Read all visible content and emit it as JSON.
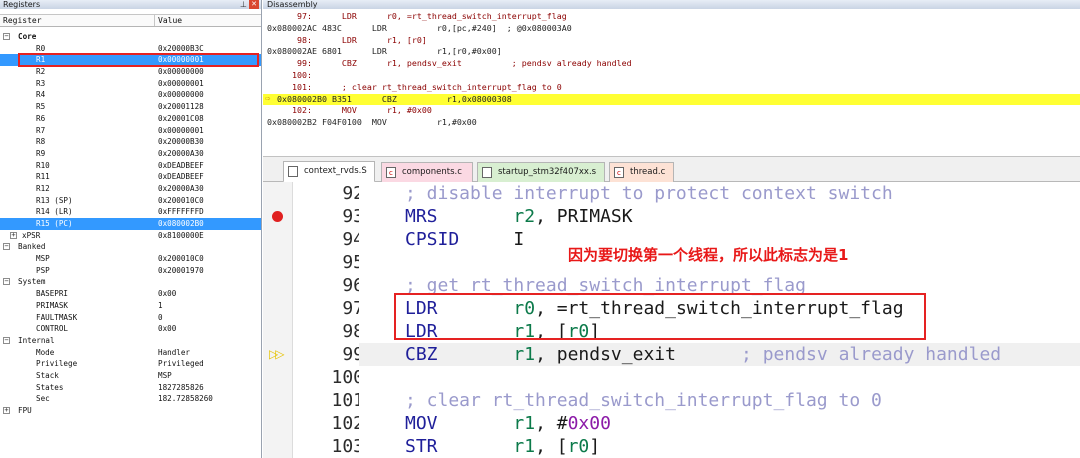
{
  "registers_panel": {
    "title": "Registers",
    "close_label": "✕",
    "pin_label": "⊥",
    "col_register": "Register",
    "col_value": "Value",
    "rows": [
      {
        "name": "Core",
        "value": "",
        "level": 0,
        "expander": "−",
        "group": true
      },
      {
        "name": "R0",
        "value": "0x20000B3C",
        "level": 2
      },
      {
        "name": "R1",
        "value": "0x00000001",
        "level": 2,
        "selected": true
      },
      {
        "name": "R2",
        "value": "0x00000000",
        "level": 2
      },
      {
        "name": "R3",
        "value": "0x00000001",
        "level": 2
      },
      {
        "name": "R4",
        "value": "0x00000000",
        "level": 2
      },
      {
        "name": "R5",
        "value": "0x20001128",
        "level": 2
      },
      {
        "name": "R6",
        "value": "0x20001C08",
        "level": 2
      },
      {
        "name": "R7",
        "value": "0x00000001",
        "level": 2
      },
      {
        "name": "R8",
        "value": "0x20000B30",
        "level": 2
      },
      {
        "name": "R9",
        "value": "0x20000A30",
        "level": 2
      },
      {
        "name": "R10",
        "value": "0xDEADBEEF",
        "level": 2
      },
      {
        "name": "R11",
        "value": "0xDEADBEEF",
        "level": 2
      },
      {
        "name": "R12",
        "value": "0x20000A30",
        "level": 2
      },
      {
        "name": "R13 (SP)",
        "value": "0x200010C0",
        "level": 2
      },
      {
        "name": "R14 (LR)",
        "value": "0xFFFFFFFD",
        "level": 2
      },
      {
        "name": "R15 (PC)",
        "value": "0x080002B0",
        "level": 2,
        "selected": true
      },
      {
        "name": "xPSR",
        "value": "0x8100000E",
        "level": 1,
        "expander": "+"
      },
      {
        "name": "Banked",
        "value": "",
        "level": 0,
        "expander": "−"
      },
      {
        "name": "MSP",
        "value": "0x200010C0",
        "level": 2
      },
      {
        "name": "PSP",
        "value": "0x20001970",
        "level": 2
      },
      {
        "name": "System",
        "value": "",
        "level": 0,
        "expander": "−"
      },
      {
        "name": "BASEPRI",
        "value": "0x00",
        "level": 2
      },
      {
        "name": "PRIMASK",
        "value": "1",
        "level": 2
      },
      {
        "name": "FAULTMASK",
        "value": "0",
        "level": 2
      },
      {
        "name": "CONTROL",
        "value": "0x00",
        "level": 2
      },
      {
        "name": "Internal",
        "value": "",
        "level": 0,
        "expander": "−"
      },
      {
        "name": "Mode",
        "value": "Handler",
        "level": 2
      },
      {
        "name": "Privilege",
        "value": "Privileged",
        "level": 2
      },
      {
        "name": "Stack",
        "value": "MSP",
        "level": 2
      },
      {
        "name": "States",
        "value": "1827285826",
        "level": 2
      },
      {
        "name": "Sec",
        "value": "182.72858260",
        "level": 2
      },
      {
        "name": "FPU",
        "value": "",
        "level": 0,
        "expander": "+"
      }
    ]
  },
  "disassembly": {
    "title": "Disassembly",
    "lines": [
      {
        "text": "      97:      LDR      r0, =rt_thread_switch_interrupt_flag",
        "kind": "src"
      },
      {
        "text": "0x080002AC 483C      LDR          r0,[pc,#240]  ; @0x080003A0",
        "kind": "addr"
      },
      {
        "text": "      98:      LDR      r1, [r0]",
        "kind": "src"
      },
      {
        "text": "0x080002AE 6801      LDR          r1,[r0,#0x00]",
        "kind": "addr"
      },
      {
        "text": "      99:      CBZ      r1, pendsv_exit          ; pendsv already handled",
        "kind": "src"
      },
      {
        "text": "     100:",
        "kind": "src"
      },
      {
        "text": "     101:      ; clear rt_thread_switch_interrupt_flag to 0",
        "kind": "src"
      },
      {
        "text": "0x080002B0 B351      CBZ          r1,0x08000308",
        "kind": "cur"
      },
      {
        "text": "     102:      MOV      r1, #0x00",
        "kind": "src"
      },
      {
        "text": "0x080002B2 F04F0100  MOV          r1,#0x00",
        "kind": "addr"
      }
    ]
  },
  "tabs": [
    {
      "label": "context_rvds.S",
      "active": true
    },
    {
      "label": "components.c"
    },
    {
      "label": "startup_stm32f407xx.s"
    },
    {
      "label": "thread.c"
    }
  ],
  "editor": {
    "lines": [
      {
        "no": "92",
        "parts": [
          {
            "t": "; disable interrupt to protect context switch",
            "c": "cmt",
            "col": 0
          }
        ]
      },
      {
        "no": "93",
        "bp": true,
        "parts": [
          {
            "t": "MRS",
            "c": "kw",
            "col": 0
          },
          {
            "t": "r2",
            "c": "reg",
            "col": 10
          },
          {
            "t": ", PRIMASK",
            "c": "op",
            "col": 12
          }
        ]
      },
      {
        "no": "94",
        "parts": [
          {
            "t": "CPSID",
            "c": "kw",
            "col": 0
          },
          {
            "t": "I",
            "c": "op",
            "col": 10
          }
        ]
      },
      {
        "no": "95",
        "parts": []
      },
      {
        "no": "96",
        "parts": [
          {
            "t": "; get rt_thread_switch_interrupt_flag",
            "c": "cmt",
            "col": 0
          }
        ]
      },
      {
        "no": "97",
        "parts": [
          {
            "t": "LDR",
            "c": "kw",
            "col": 0
          },
          {
            "t": "r0",
            "c": "reg",
            "col": 10
          },
          {
            "t": ", =rt_thread_switch_interrupt_flag",
            "c": "op",
            "col": 12
          }
        ]
      },
      {
        "no": "98",
        "parts": [
          {
            "t": "LDR",
            "c": "kw",
            "col": 0
          },
          {
            "t": "r1",
            "c": "reg",
            "col": 10
          },
          {
            "t": ", [",
            "c": "op",
            "col": 12
          },
          {
            "t": "r0",
            "c": "reg",
            "col": 15
          },
          {
            "t": "]",
            "c": "op",
            "col": 17
          }
        ]
      },
      {
        "no": "99",
        "pc": true,
        "cur": true,
        "parts": [
          {
            "t": "CBZ",
            "c": "kw",
            "col": 0
          },
          {
            "t": "r1",
            "c": "reg",
            "col": 10
          },
          {
            "t": ", pendsv_exit",
            "c": "op",
            "col": 12
          },
          {
            "t": "; pendsv already handled",
            "c": "cmt",
            "col": 31
          }
        ]
      },
      {
        "no": "100",
        "parts": []
      },
      {
        "no": "101",
        "parts": [
          {
            "t": "; clear rt_thread_switch_interrupt_flag to 0",
            "c": "cmt",
            "col": 0
          }
        ]
      },
      {
        "no": "102",
        "parts": [
          {
            "t": "MOV",
            "c": "kw",
            "col": 0
          },
          {
            "t": "r1",
            "c": "reg",
            "col": 10
          },
          {
            "t": ", #",
            "c": "op",
            "col": 12
          },
          {
            "t": "0x00",
            "c": "num",
            "col": 15
          }
        ]
      },
      {
        "no": "103",
        "parts": [
          {
            "t": "STR",
            "c": "kw",
            "col": 0
          },
          {
            "t": "r1",
            "c": "reg",
            "col": 10
          },
          {
            "t": ", [",
            "c": "op",
            "col": 12
          },
          {
            "t": "r0",
            "c": "reg",
            "col": 15
          },
          {
            "t": "]",
            "c": "op",
            "col": 17
          }
        ]
      }
    ]
  },
  "annotation": "因为要切换第一个线程，所以此标志为是1"
}
